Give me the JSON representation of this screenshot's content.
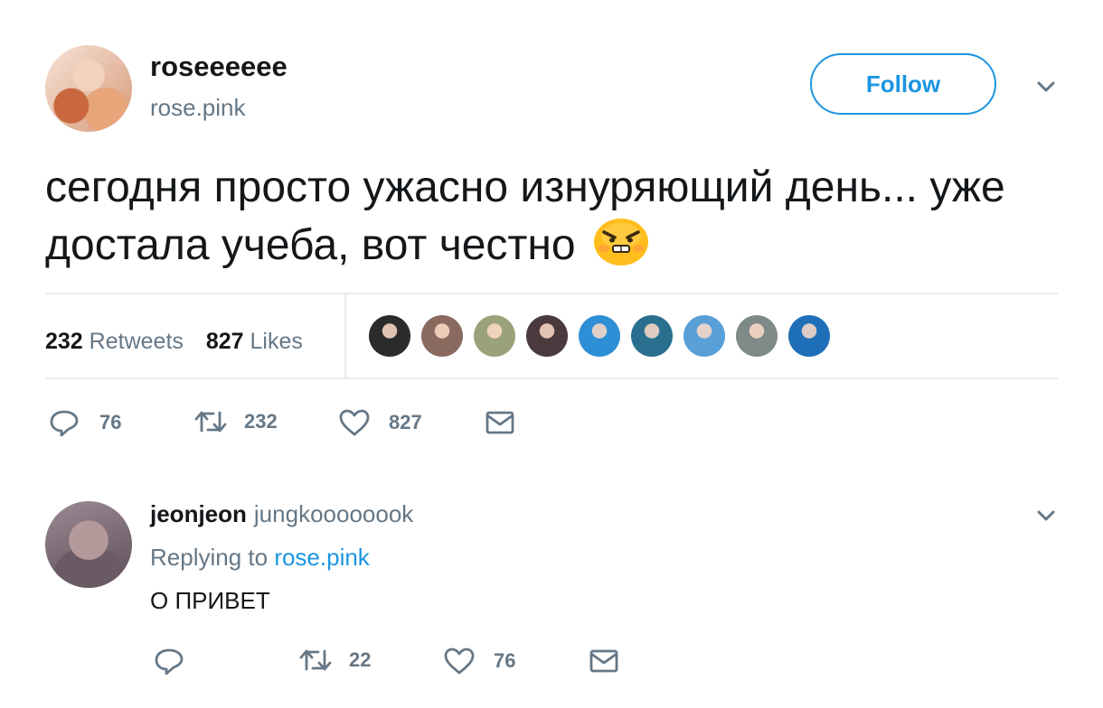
{
  "tweet": {
    "display_name": "roseeeeee",
    "handle": "rose.pink",
    "follow_label": "Follow",
    "text": "сегодня просто ужасно изнуряющий день... уже достала учеба, вот честно",
    "emoji": "angry-face-emoji",
    "retweets_count": "232",
    "retweets_label": "Retweets",
    "likes_count": "827",
    "likes_label": "Likes",
    "likers": [
      {
        "color": "#2b2b2b"
      },
      {
        "color": "#8a6a5e"
      },
      {
        "color": "#9aa27a"
      },
      {
        "color": "#4a3a3e"
      },
      {
        "color": "#2f8fd6"
      },
      {
        "color": "#2a6f8f"
      },
      {
        "color": "#5aa0d8"
      },
      {
        "color": "#7d8a88"
      },
      {
        "color": "#1f6fb8"
      }
    ],
    "actions": {
      "replies": "76",
      "retweets": "232",
      "likes": "827"
    }
  },
  "reply": {
    "display_name": "jeonjeon",
    "handle": "jungkoooooook",
    "replying_prefix": "Replying to",
    "replying_to": "rose.pink",
    "text": "О ПРИВЕТ",
    "actions": {
      "retweets": "22",
      "likes": "76"
    }
  },
  "colors": {
    "accent": "#1b95e0",
    "secondary_text": "#657786",
    "divider": "#e6ecf0"
  }
}
